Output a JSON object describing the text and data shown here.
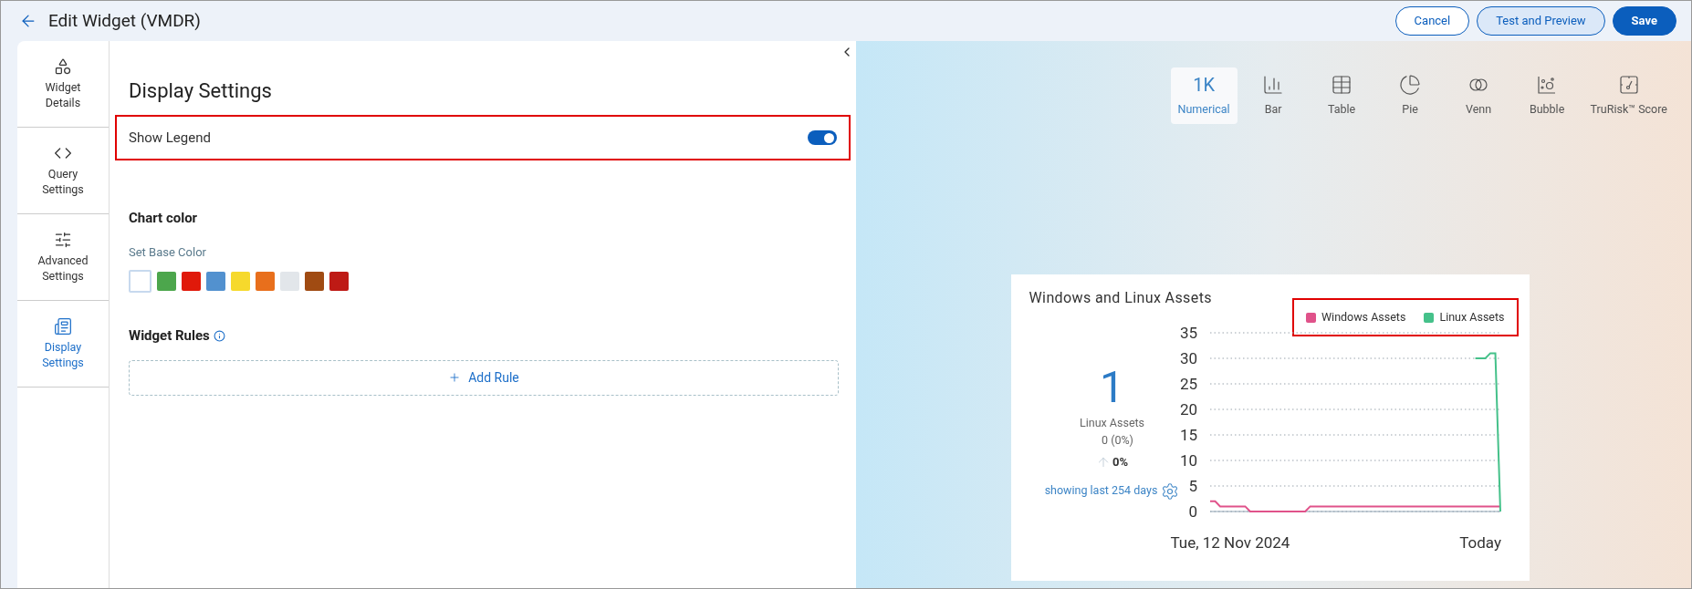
{
  "header": {
    "title": "Edit Widget (VMDR)",
    "buttons": [
      {
        "label": "Cancel",
        "kind": "outline"
      },
      {
        "label": "Test and Preview",
        "kind": "soft"
      },
      {
        "label": "Save",
        "kind": "primary"
      }
    ]
  },
  "sidebar": {
    "items": [
      {
        "label": "Widget Details",
        "kind": "details",
        "selected": false
      },
      {
        "label": "Query Settings",
        "kind": "query",
        "selected": false
      },
      {
        "label": "Advanced Settings",
        "kind": "advanced",
        "selected": false
      },
      {
        "label": "Display Settings",
        "kind": "display",
        "selected": true
      }
    ]
  },
  "settings": {
    "title": "Display Settings",
    "show_legend": {
      "label": "Show Legend",
      "on": true,
      "highlighted": true
    },
    "chart_color": {
      "heading": "Chart color",
      "label": "Set Base Color",
      "swatches": [
        {
          "color": "#ffffff",
          "selected": true
        },
        {
          "color": "#4ca64c",
          "selected": false
        },
        {
          "color": "#e0190a",
          "selected": false
        },
        {
          "color": "#5291cf",
          "selected": false
        },
        {
          "color": "#f6d92c",
          "selected": false
        },
        {
          "color": "#e86f1c",
          "selected": false
        },
        {
          "color": "#e2e6ea",
          "selected": false
        },
        {
          "color": "#a04b12",
          "selected": false
        },
        {
          "color": "#be1a15",
          "selected": false
        }
      ]
    },
    "widget_rules": {
      "heading": "Widget Rules",
      "add_label": "Add Rule"
    }
  },
  "chart_types": [
    {
      "label": "Numerical",
      "kind": "numerical",
      "glyph": "1K",
      "selected": true
    },
    {
      "label": "Bar",
      "kind": "bar",
      "selected": false
    },
    {
      "label": "Table",
      "kind": "table",
      "selected": false
    },
    {
      "label": "Pie",
      "kind": "pie",
      "selected": false
    },
    {
      "label": "Venn",
      "kind": "venn",
      "selected": false
    },
    {
      "label": "Bubble",
      "kind": "bubble",
      "selected": false
    },
    {
      "label": "TruRisk™ Score",
      "kind": "trurisk",
      "selected": false
    }
  ],
  "widget": {
    "title": "Windows and Linux Assets",
    "value": "1",
    "value_label": "Linux Assets",
    "change": "0 (0%)",
    "trend": "0%",
    "period": "showing last 254 days",
    "legend_highlighted": true,
    "chart_data": {
      "type": "line",
      "categories": [
        null,
        null,
        null,
        null,
        "Tue, 12 Nov 2024",
        null,
        null,
        null,
        null,
        null,
        null,
        null,
        null,
        null,
        null,
        null,
        null,
        null,
        null,
        null,
        null,
        null,
        null,
        null,
        null,
        null,
        null,
        null,
        null,
        null,
        null,
        null,
        null,
        null,
        null,
        null,
        null,
        null,
        null,
        null,
        null,
        null,
        null,
        null,
        null,
        null,
        null,
        null,
        null,
        null,
        null,
        null,
        null,
        null,
        "Today",
        null,
        null,
        null,
        null
      ],
      "series": [
        {
          "name": "Windows Assets",
          "color": "#e0528a",
          "values": [
            2,
            2,
            1,
            1,
            1,
            1,
            1,
            1,
            0,
            0,
            0,
            0,
            0,
            0,
            0,
            0,
            0,
            0,
            0,
            0,
            1,
            1,
            1,
            1,
            1,
            1,
            1,
            1,
            1,
            1,
            1,
            1,
            1,
            1,
            1,
            1,
            1,
            1,
            1,
            1,
            1,
            1,
            1,
            1,
            1,
            1,
            1,
            1,
            1,
            1,
            1,
            1,
            1,
            1,
            1,
            1,
            1,
            1,
            1
          ]
        },
        {
          "name": "Linux Assets",
          "color": "#45c18a",
          "values": [
            null,
            null,
            null,
            null,
            null,
            null,
            null,
            null,
            null,
            null,
            null,
            null,
            null,
            null,
            null,
            null,
            null,
            null,
            null,
            null,
            null,
            null,
            null,
            null,
            null,
            null,
            null,
            null,
            null,
            null,
            null,
            null,
            null,
            null,
            null,
            null,
            null,
            null,
            null,
            null,
            null,
            null,
            null,
            null,
            null,
            null,
            null,
            null,
            null,
            null,
            null,
            null,
            null,
            30,
            30,
            30,
            31,
            31,
            0
          ]
        }
      ],
      "grid": true,
      "ylim": [
        0,
        35
      ],
      "yticks": [
        0,
        5,
        10,
        15,
        20,
        25,
        30,
        35
      ]
    }
  }
}
